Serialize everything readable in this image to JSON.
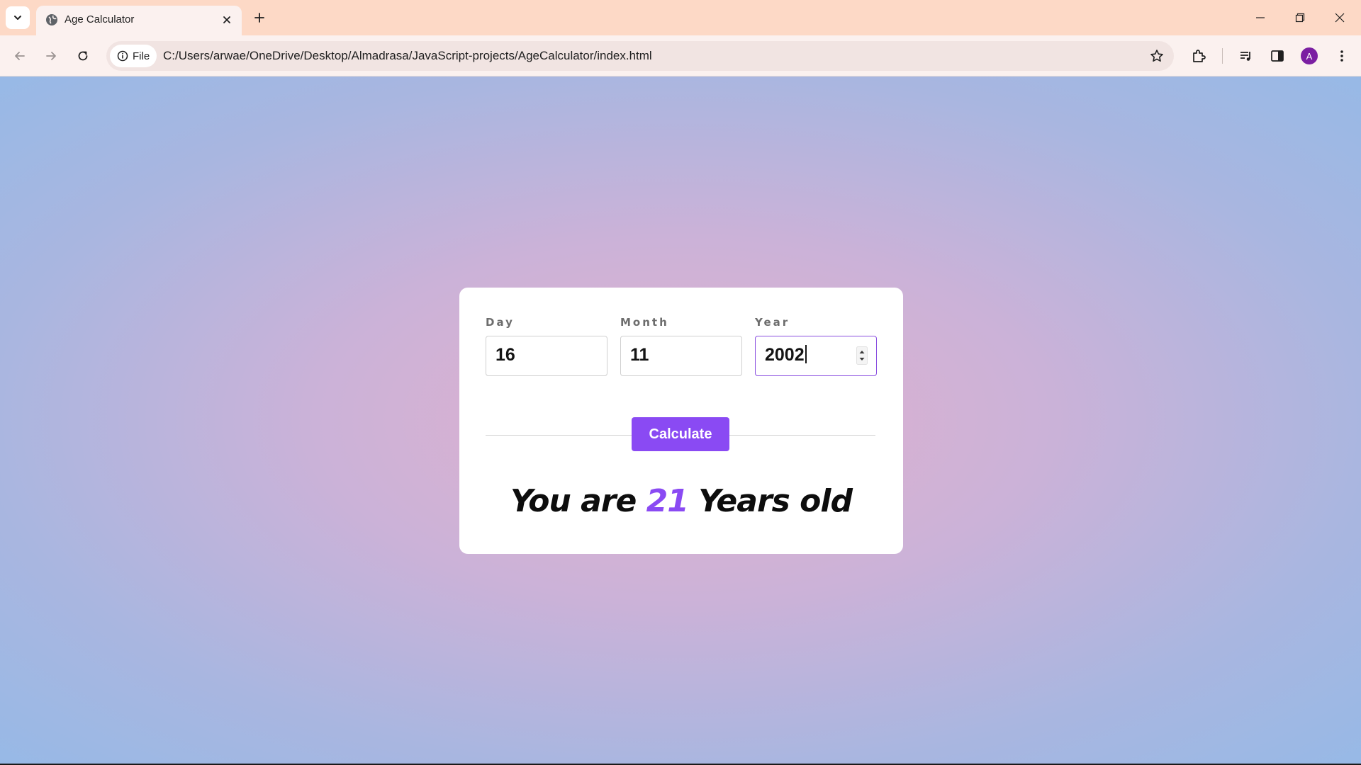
{
  "browser": {
    "tab_title": "Age Calculator",
    "site_chip_label": "File",
    "url": "C:/Users/arwae/OneDrive/Desktop/Almadrasa/JavaScript-projects/AgeCalculator/index.html",
    "profile_initial": "A",
    "accent_colors": {
      "tabbar": "#fdd9c6",
      "toolbar": "#fbf1ef",
      "profile": "#7b1fa2"
    }
  },
  "form": {
    "day": {
      "label": "Day",
      "value": "16"
    },
    "month": {
      "label": "Month",
      "value": "11"
    },
    "year": {
      "label": "Year",
      "value": "2002"
    },
    "calculate_label": "Calculate"
  },
  "result": {
    "prefix": "You are",
    "age": "21",
    "suffix": "Years old"
  },
  "colors": {
    "accent": "#8a4af3"
  }
}
